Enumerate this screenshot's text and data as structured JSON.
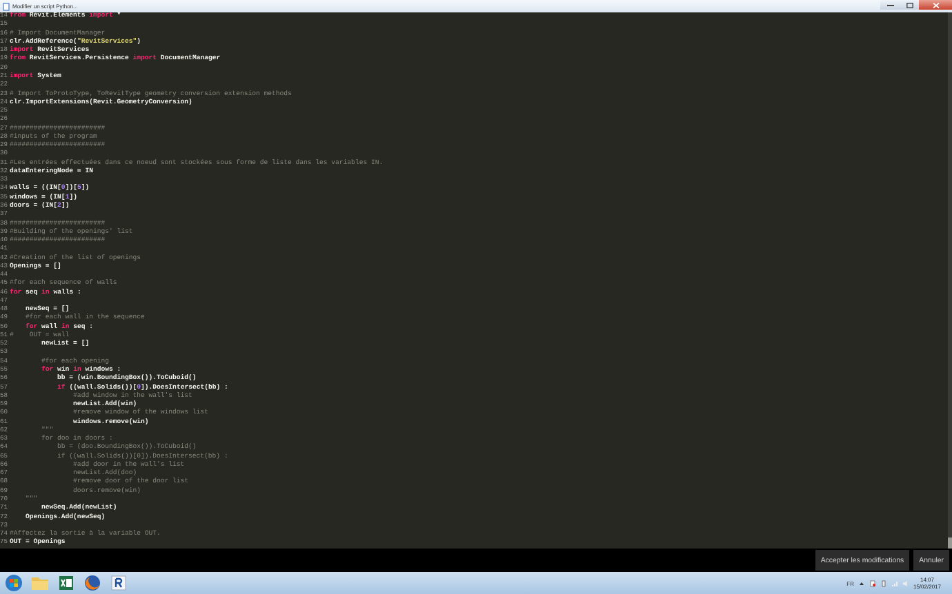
{
  "window": {
    "title": "Modifier un script Python..."
  },
  "editor": {
    "lines": [
      {
        "number": "14",
        "tokens": [
          {
            "kind": "kw",
            "text": "from"
          },
          {
            "kind": "plain",
            "text": " Revit.Elements "
          },
          {
            "kind": "kw",
            "text": "import"
          },
          {
            "kind": "plain",
            "text": " *"
          }
        ]
      },
      {
        "number": "15"
      },
      {
        "number": "16",
        "tokens": [
          {
            "kind": "comment",
            "text": "# Import DocumentManager"
          }
        ]
      },
      {
        "number": "17",
        "tokens": [
          {
            "kind": "plain",
            "text": "clr.AddReference("
          },
          {
            "kind": "str",
            "text": "\"RevitServices\""
          },
          {
            "kind": "plain",
            "text": ")"
          }
        ]
      },
      {
        "number": "18",
        "tokens": [
          {
            "kind": "kw",
            "text": "import"
          },
          {
            "kind": "plain",
            "text": " RevitServices"
          }
        ]
      },
      {
        "number": "19",
        "tokens": [
          {
            "kind": "kw",
            "text": "from"
          },
          {
            "kind": "plain",
            "text": " RevitServices.Persistence "
          },
          {
            "kind": "kw",
            "text": "import"
          },
          {
            "kind": "plain",
            "text": " DocumentManager"
          }
        ]
      },
      {
        "number": "20"
      },
      {
        "number": "21",
        "tokens": [
          {
            "kind": "kw",
            "text": "import"
          },
          {
            "kind": "plain",
            "text": " System"
          }
        ]
      },
      {
        "number": "22"
      },
      {
        "number": "23",
        "tokens": [
          {
            "kind": "comment",
            "text": "# Import ToProtoType, ToRevitType geometry conversion extension methods"
          }
        ]
      },
      {
        "number": "24",
        "tokens": [
          {
            "kind": "plain",
            "text": "clr.ImportExtensions(Revit.GeometryConversion)"
          }
        ]
      },
      {
        "number": "25"
      },
      {
        "number": "26"
      },
      {
        "number": "27",
        "tokens": [
          {
            "kind": "comment",
            "text": "########################"
          }
        ]
      },
      {
        "number": "28",
        "tokens": [
          {
            "kind": "comment",
            "text": "#inputs of the program"
          }
        ]
      },
      {
        "number": "29",
        "tokens": [
          {
            "kind": "comment",
            "text": "########################"
          }
        ]
      },
      {
        "number": "30"
      },
      {
        "number": "31",
        "tokens": [
          {
            "kind": "comment",
            "text": "#Les entrées effectuées dans ce noeud sont stockées sous forme de liste dans les variables IN."
          }
        ]
      },
      {
        "number": "32",
        "tokens": [
          {
            "kind": "plain",
            "text": "dataEnteringNode = IN"
          }
        ]
      },
      {
        "number": "33"
      },
      {
        "number": "34",
        "tokens": [
          {
            "kind": "plain",
            "text": "walls = ((IN["
          },
          {
            "kind": "num",
            "text": "0"
          },
          {
            "kind": "plain",
            "text": "])["
          },
          {
            "kind": "num",
            "text": "5"
          },
          {
            "kind": "plain",
            "text": "])"
          }
        ]
      },
      {
        "number": "35",
        "tokens": [
          {
            "kind": "plain",
            "text": "windows = (IN["
          },
          {
            "kind": "num",
            "text": "1"
          },
          {
            "kind": "plain",
            "text": "])"
          }
        ]
      },
      {
        "number": "36",
        "tokens": [
          {
            "kind": "plain",
            "text": "doors = (IN["
          },
          {
            "kind": "num",
            "text": "2"
          },
          {
            "kind": "plain",
            "text": "])"
          }
        ]
      },
      {
        "number": "37"
      },
      {
        "number": "38",
        "tokens": [
          {
            "kind": "comment",
            "text": "########################"
          }
        ]
      },
      {
        "number": "39",
        "tokens": [
          {
            "kind": "comment",
            "text": "#Building of the openings' list"
          }
        ]
      },
      {
        "number": "40",
        "tokens": [
          {
            "kind": "comment",
            "text": "########################"
          }
        ]
      },
      {
        "number": "41"
      },
      {
        "number": "42",
        "tokens": [
          {
            "kind": "comment",
            "text": "#Creation of the list of openings"
          }
        ]
      },
      {
        "number": "43",
        "tokens": [
          {
            "kind": "plain",
            "text": "Openings = []"
          }
        ]
      },
      {
        "number": "44"
      },
      {
        "number": "45",
        "tokens": [
          {
            "kind": "comment",
            "text": "#for each sequence of walls"
          }
        ]
      },
      {
        "number": "46",
        "tokens": [
          {
            "kind": "kw",
            "text": "for"
          },
          {
            "kind": "plain",
            "text": " seq "
          },
          {
            "kind": "kw",
            "text": "in"
          },
          {
            "kind": "plain",
            "text": " walls :"
          }
        ]
      },
      {
        "number": "47"
      },
      {
        "number": "48",
        "tokens": [
          {
            "kind": "plain",
            "text": "    newSeq = []"
          }
        ]
      },
      {
        "number": "49",
        "tokens": [
          {
            "kind": "comment",
            "text": "    #for each wall in the sequence"
          }
        ]
      },
      {
        "number": "50",
        "tokens": [
          {
            "kind": "kw",
            "text": "    for"
          },
          {
            "kind": "plain",
            "text": " wall "
          },
          {
            "kind": "kw",
            "text": "in"
          },
          {
            "kind": "plain",
            "text": " seq :"
          }
        ]
      },
      {
        "number": "51",
        "tokens": [
          {
            "kind": "comment",
            "text": "#    OUT = wall"
          }
        ]
      },
      {
        "number": "52",
        "tokens": [
          {
            "kind": "plain",
            "text": "        newList = []"
          }
        ]
      },
      {
        "number": "53"
      },
      {
        "number": "54",
        "tokens": [
          {
            "kind": "comment",
            "text": "        #for each opening"
          }
        ]
      },
      {
        "number": "55",
        "tokens": [
          {
            "kind": "kw",
            "text": "        for"
          },
          {
            "kind": "plain",
            "text": " win "
          },
          {
            "kind": "kw",
            "text": "in"
          },
          {
            "kind": "plain",
            "text": " windows :"
          }
        ]
      },
      {
        "number": "56",
        "tokens": [
          {
            "kind": "plain",
            "text": "            bb = (win.BoundingBox()).ToCuboid()"
          }
        ]
      },
      {
        "number": "57",
        "tokens": [
          {
            "kind": "kw",
            "text": "            if"
          },
          {
            "kind": "plain",
            "text": " ((wall.Solids())["
          },
          {
            "kind": "num",
            "text": "0"
          },
          {
            "kind": "plain",
            "text": "]).DoesIntersect(bb) :"
          }
        ]
      },
      {
        "number": "58",
        "tokens": [
          {
            "kind": "comment",
            "text": "                #add window in the wall's list"
          }
        ]
      },
      {
        "number": "59",
        "tokens": [
          {
            "kind": "plain",
            "text": "                newList.Add(win)"
          }
        ]
      },
      {
        "number": "60",
        "tokens": [
          {
            "kind": "comment",
            "text": "                #remove window of the windows list"
          }
        ]
      },
      {
        "number": "61",
        "tokens": [
          {
            "kind": "plain",
            "text": "                windows.remove(win)"
          }
        ]
      },
      {
        "number": "62",
        "tokens": [
          {
            "kind": "comment",
            "text": "        \"\"\""
          }
        ]
      },
      {
        "number": "63",
        "tokens": [
          {
            "kind": "comment",
            "text": "        for doo in doors :"
          }
        ]
      },
      {
        "number": "64",
        "tokens": [
          {
            "kind": "comment",
            "text": "            bb = (doo.BoundingBox()).ToCuboid()"
          }
        ]
      },
      {
        "number": "65",
        "tokens": [
          {
            "kind": "comment",
            "text": "            if ((wall.Solids())[0]).DoesIntersect(bb) :"
          }
        ]
      },
      {
        "number": "66",
        "tokens": [
          {
            "kind": "comment",
            "text": "                #add door in the wall's list"
          }
        ]
      },
      {
        "number": "67",
        "tokens": [
          {
            "kind": "comment",
            "text": "                newList.Add(doo)"
          }
        ]
      },
      {
        "number": "68",
        "tokens": [
          {
            "kind": "comment",
            "text": "                #remove door of the door list"
          }
        ]
      },
      {
        "number": "69",
        "tokens": [
          {
            "kind": "comment",
            "text": "                doors.remove(win)"
          }
        ]
      },
      {
        "number": "70",
        "tokens": [
          {
            "kind": "comment",
            "text": "    \"\"\""
          }
        ]
      },
      {
        "number": "71",
        "tokens": [
          {
            "kind": "plain",
            "text": "        newSeq.Add(newList)"
          }
        ]
      },
      {
        "number": "72",
        "tokens": [
          {
            "kind": "plain",
            "text": "    Openings.Add(newSeq)"
          }
        ]
      },
      {
        "number": "73"
      },
      {
        "number": "74",
        "tokens": [
          {
            "kind": "comment",
            "text": "#Affectez la sortie à la variable OUT."
          }
        ]
      },
      {
        "number": "75",
        "tokens": [
          {
            "kind": "plain",
            "text": "OUT = Openings"
          }
        ]
      }
    ]
  },
  "buttons": [
    "Accepter les modifications",
    "Annuler"
  ],
  "taskbar": {
    "language": "FR",
    "time": "14:07",
    "date": "15/02/2017"
  }
}
